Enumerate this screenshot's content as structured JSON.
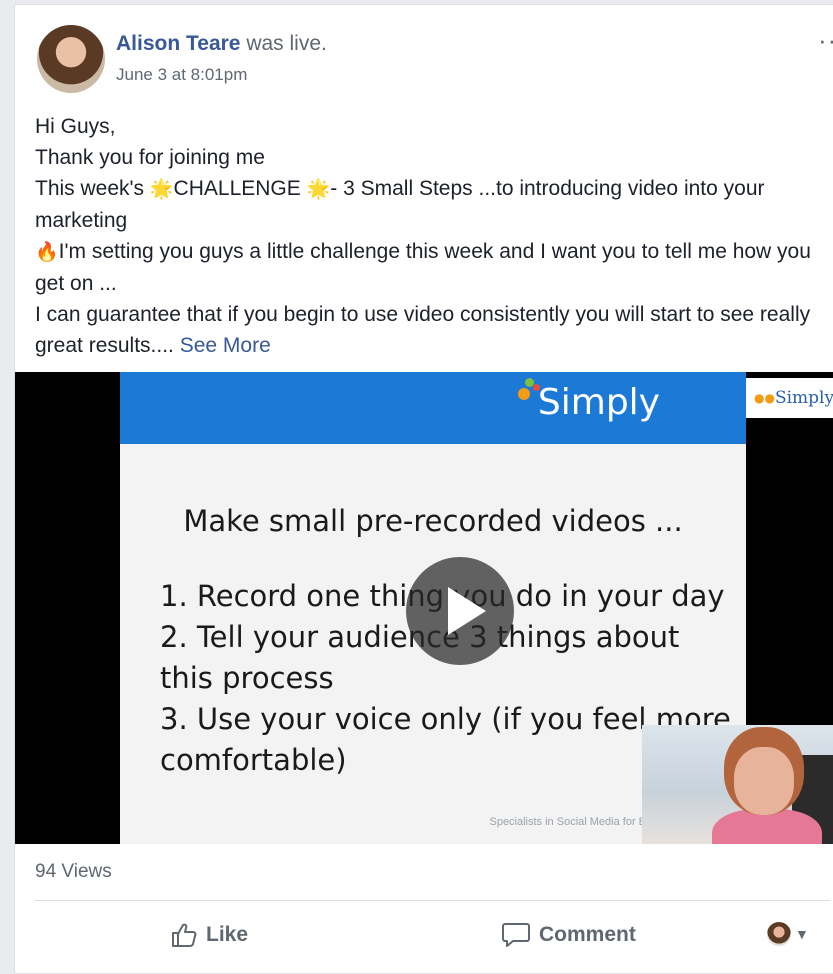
{
  "post": {
    "author": "Alison Teare",
    "action": " was live.",
    "timestamp": "June 3 at 8:01pm",
    "more_icon": "···",
    "body": {
      "line1": "Hi Guys,",
      "line2": "Thank you for joining me",
      "line3_pre": "This week's ",
      "line3_emoji1": "🌟",
      "line3_mid": "CHALLENGE ",
      "line3_emoji2": "🌟",
      "line3_post": "- 3 Small Steps ...to introducing video into your marketing",
      "line4_emoji": "🔥",
      "line4": "I'm setting you guys a little challenge this week and I want you to tell me how you get on ...",
      "line5": "I can guarantee that if you begin to use video consistently you will start to see really great results.... ",
      "see_more": "See More"
    }
  },
  "video": {
    "slide_logo": "Simply",
    "side_logo": "Simply",
    "slide_title": "Make small pre-recorded videos ...",
    "slide_items": [
      "1. Record one thing you do in your day",
      "2. Tell your audience 3 things about this process",
      "3. Use your voice only (if you feel more comfortable)"
    ],
    "slide_footer": "Specialists in Social Media for B"
  },
  "stats": {
    "views": "94 Views"
  },
  "actions": {
    "like": "Like",
    "comment": "Comment"
  },
  "colors": {
    "link": "#385898",
    "banner": "#1c7ad6",
    "muted": "#606770"
  }
}
